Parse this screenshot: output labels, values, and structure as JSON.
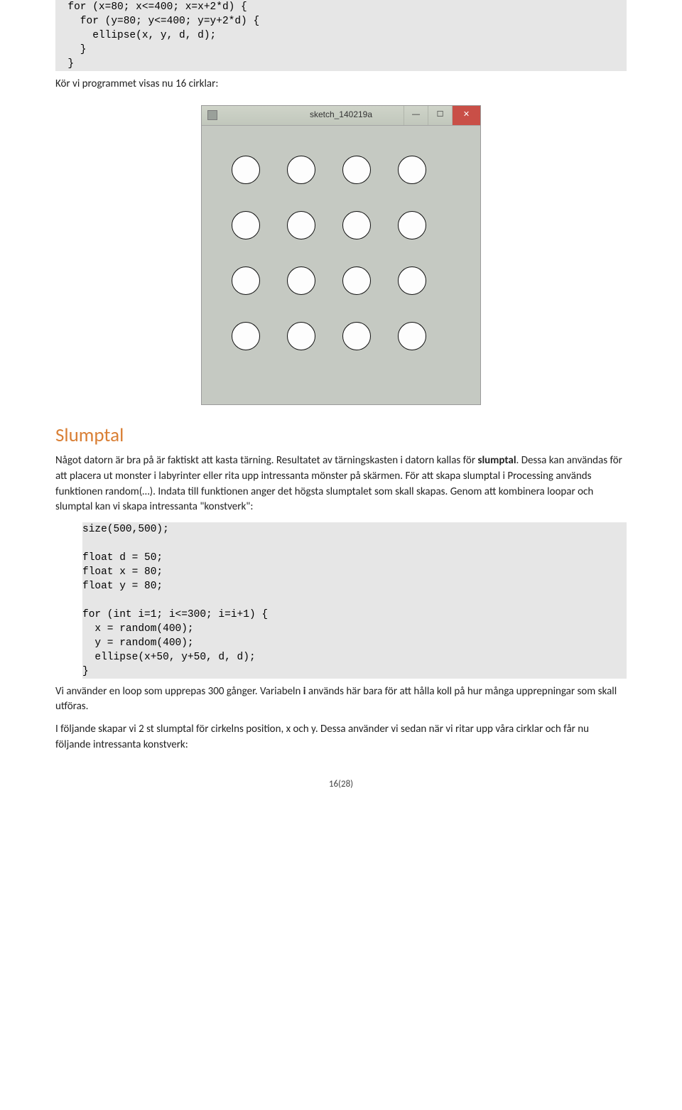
{
  "codeTop": "  for (x=80; x<=400; x=x+2*d) {\n    for (y=80; y<=400; y=y+2*d) {\n      ellipse(x, y, d, d);\n    }\n  }",
  "p1": "Kör vi programmet visas nu 16 cirklar:",
  "sketch": {
    "title": "sketch_140219a",
    "min": "—",
    "max": "☐",
    "close": "✕"
  },
  "hdrSlumptal": "Slumptal",
  "p2a": "Något datorn är bra på är faktiskt att kasta tärning. Resultatet av tärningskasten i datorn kallas för ",
  "p2b": "slumptal",
  "p2c": ". Dessa kan användas för att placera ut monster i labyrinter eller rita upp intressanta mönster på skärmen. För att skapa slumptal i Processing används funktionen random(…). Indata till funktionen anger det högsta slumptalet som skall skapas. Genom att kombinera loopar och slumptal kan vi skapa intressanta \"konstverk\":",
  "codeMid": "size(500,500);\n\nfloat d = 50;\nfloat x = 80;\nfloat y = 80;\n\nfor (int i=1; i<=300; i=i+1) {\n  x = random(400);\n  y = random(400);\n  ellipse(x+50, y+50, d, d);\n}",
  "p3a": "Vi använder en loop som upprepas 300 gånger. Variabeln ",
  "p3b": "i",
  "p3c": " används här bara för att hålla koll på hur många upprepningar som skall utföras.",
  "p4": "I följande skapar vi 2 st slumptal för cirkelns position, x och y. Dessa använder vi sedan när vi ritar upp våra cirklar och får nu följande intressanta konstverk:",
  "pageNum": "16(28)",
  "grid": {
    "start": 62,
    "step": 78,
    "count": 4,
    "offset": 20
  }
}
